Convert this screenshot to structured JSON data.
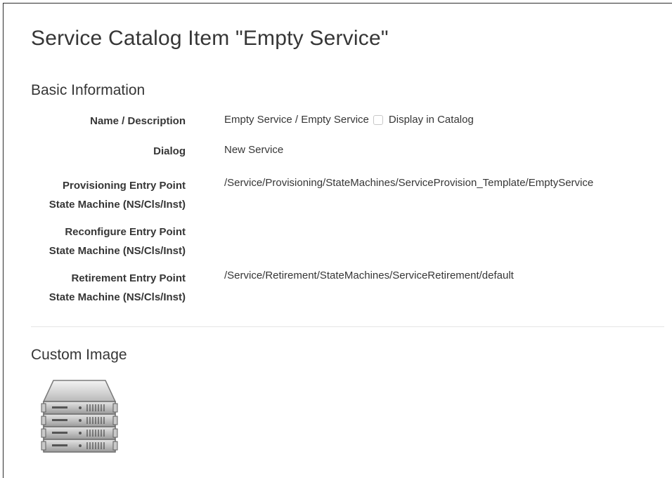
{
  "page": {
    "title": "Service Catalog Item \"Empty Service\""
  },
  "basic_info": {
    "heading": "Basic Information",
    "rows": [
      {
        "label_line1": "Name / Description",
        "label_line2": "",
        "value": "Empty Service / Empty Service",
        "checkbox_label": "Display in Catalog",
        "checkbox_checked": false
      },
      {
        "label_line1": "Dialog",
        "label_line2": "",
        "value": "New Service"
      },
      {
        "label_line1": "Provisioning Entry Point",
        "label_line2": "State Machine (NS/Cls/Inst)",
        "value": "/Service/Provisioning/StateMachines/ServiceProvision_Template/EmptyService"
      },
      {
        "label_line1": "Reconfigure Entry Point",
        "label_line2": "State Machine (NS/Cls/Inst)",
        "value": ""
      },
      {
        "label_line1": "Retirement Entry Point",
        "label_line2": "State Machine (NS/Cls/Inst)",
        "value": "/Service/Retirement/StateMachines/ServiceRetirement/default"
      }
    ]
  },
  "custom_image": {
    "heading": "Custom Image",
    "icon": "server-rack-icon"
  }
}
